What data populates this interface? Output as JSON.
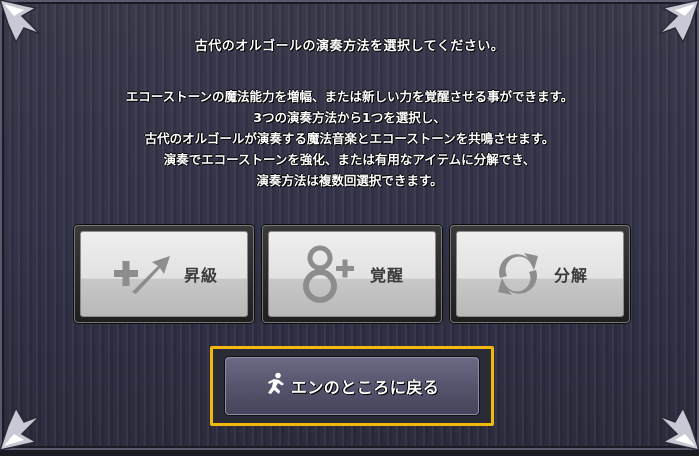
{
  "dialog": {
    "title": "古代のオルゴールの演奏方法を選択してください。",
    "description_lines": [
      "エコーストーンの魔法能力を増幅、または新しい力を覚醒させる事ができます。",
      "3つの演奏方法から1つを選択し、",
      "古代のオルゴールが演奏する魔法音楽とエコーストーンを共鳴させます。",
      "演奏でエコーストーンを強化、または有用なアイテムに分解でき、",
      "演奏方法は複数回選択できます。"
    ]
  },
  "options": [
    {
      "label": "昇級",
      "icon": "plus-arrow-icon"
    },
    {
      "label": "覚醒",
      "icon": "awaken-circles-icon"
    },
    {
      "label": "分解",
      "icon": "cycle-arrows-icon"
    }
  ],
  "back_button": {
    "label": "エンのところに戻る",
    "icon": "running-figure-icon"
  },
  "colors": {
    "highlight": "#f2b90c",
    "panel_bg": "#34344a",
    "option_bg": "#e6e6e6",
    "icon_gray": "#8d8d8d",
    "text": "#ffffff"
  }
}
